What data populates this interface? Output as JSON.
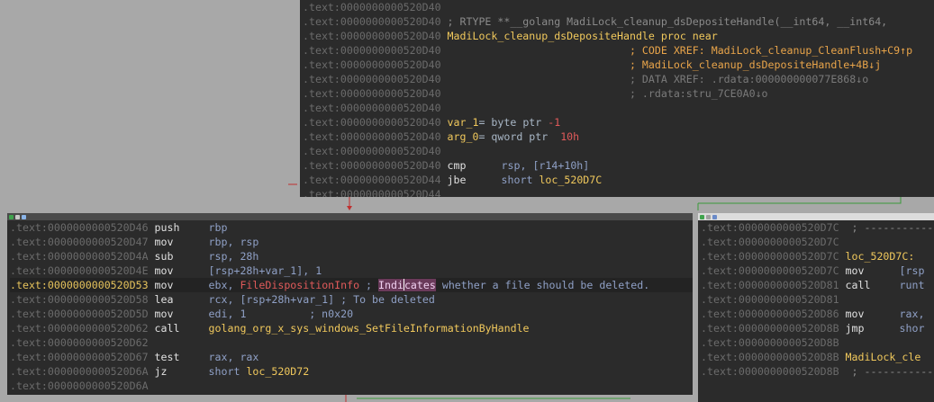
{
  "top": {
    "lines": [
      {
        "addr": ".text:0000000000520D40",
        "rest": ""
      },
      {
        "addr": ".text:0000000000520D40",
        "rest": "; RTYPE **__golang MadiLock_cleanup_dsDepositeHandle(__int64, __int64,"
      },
      {
        "addr": ".text:0000000000520D40",
        "name": "MadiLock_cleanup_dsDepositeHandle",
        "kw": "proc near"
      },
      {
        "addr": ".text:0000000000520D40",
        "pad": "                             ",
        "xref": "; CODE XREF: MadiLock_cleanup_CleanFlush+C9↑p"
      },
      {
        "addr": ".text:0000000000520D40",
        "pad": "                             ",
        "xref": "; MadiLock_cleanup_dsDepositeHandle+4B↓j"
      },
      {
        "addr": ".text:0000000000520D40",
        "pad": "                             ",
        "dxref": "; DATA XREF: .rdata:000000000077E868↓o"
      },
      {
        "addr": ".text:0000000000520D40",
        "pad": "                             ",
        "dxref": "; .rdata:stru_7CE0A0↓o"
      },
      {
        "addr": ".text:0000000000520D40",
        "rest": ""
      },
      {
        "addr": ".text:0000000000520D40",
        "var": "var_1= byte ptr -1"
      },
      {
        "addr": ".text:0000000000520D40",
        "var": "arg_0= qword ptr  10h"
      },
      {
        "addr": ".text:0000000000520D40",
        "rest": ""
      },
      {
        "addr": ".text:0000000000520D40",
        "mn": "cmp",
        "op": "rsp, [r14+10h]"
      },
      {
        "addr": ".text:0000000000520D44",
        "mn": "jbe",
        "op": "short",
        "target": "loc_520D7C"
      },
      {
        "addr": ".text:0000000000520D44",
        "rest": ""
      }
    ]
  },
  "left": {
    "lines": [
      {
        "addr": ".text:0000000000520D46",
        "mn": "push",
        "op": "rbp"
      },
      {
        "addr": ".text:0000000000520D47",
        "mn": "mov",
        "op": "rbp, rsp"
      },
      {
        "addr": ".text:0000000000520D4A",
        "mn": "sub",
        "op": "rsp, 28h"
      },
      {
        "addr": ".text:0000000000520D4E",
        "mn": "mov",
        "op": "[rsp+28h+var_1], 1"
      },
      {
        "addr": ".text:0000000000520D53",
        "mn": "mov",
        "op": "ebx,",
        "op2": "FileDispositionInfo",
        "cmt": " ; Indicates whether a file should be deleted.",
        "current": true
      },
      {
        "addr": ".text:0000000000520D58",
        "mn": "lea",
        "op": "rcx, [rsp+28h+var_1] ; To be deleted"
      },
      {
        "addr": ".text:0000000000520D5D",
        "mn": "mov",
        "op": "edi, 1          ; n0x20"
      },
      {
        "addr": ".text:0000000000520D62",
        "mn": "call",
        "op": "",
        "target": "golang_org_x_sys_windows_SetFileInformationByHandle"
      },
      {
        "addr": ".text:0000000000520D62",
        "rest": ""
      },
      {
        "addr": ".text:0000000000520D67",
        "mn": "test",
        "op": "rax, rax"
      },
      {
        "addr": ".text:0000000000520D6A",
        "mn": "jz",
        "op": "short",
        "target": "loc_520D72"
      },
      {
        "addr": ".text:0000000000520D6A",
        "rest": ""
      }
    ]
  },
  "right": {
    "lines": [
      {
        "addr": ".text:0000000000520D7C",
        "rest": " ; -----------"
      },
      {
        "addr": ".text:0000000000520D7C",
        "rest": ""
      },
      {
        "addr": ".text:0000000000520D7C",
        "label": "loc_520D7C:"
      },
      {
        "addr": ".text:0000000000520D7C",
        "mn": "mov",
        "op": "[rsp"
      },
      {
        "addr": ".text:0000000000520D81",
        "mn": "call",
        "op": "runt"
      },
      {
        "addr": ".text:0000000000520D81",
        "rest": ""
      },
      {
        "addr": ".text:0000000000520D86",
        "mn": "mov",
        "op": "rax,"
      },
      {
        "addr": ".text:0000000000520D8B",
        "mn": "jmp",
        "op": "shor"
      },
      {
        "addr": ".text:0000000000520D8B",
        "rest": ""
      },
      {
        "addr": ".text:0000000000520D8B",
        "label": "MadiLock_cle"
      },
      {
        "addr": ".text:0000000000520D8B",
        "rest": " ; -----------"
      }
    ]
  },
  "colors": {
    "background": "#a8a8a8",
    "node": "#2b2b2b",
    "address": "#6b6b6b",
    "name": "#f0c85c",
    "comment": "#8a8a8a",
    "number": "#e05a5a"
  }
}
